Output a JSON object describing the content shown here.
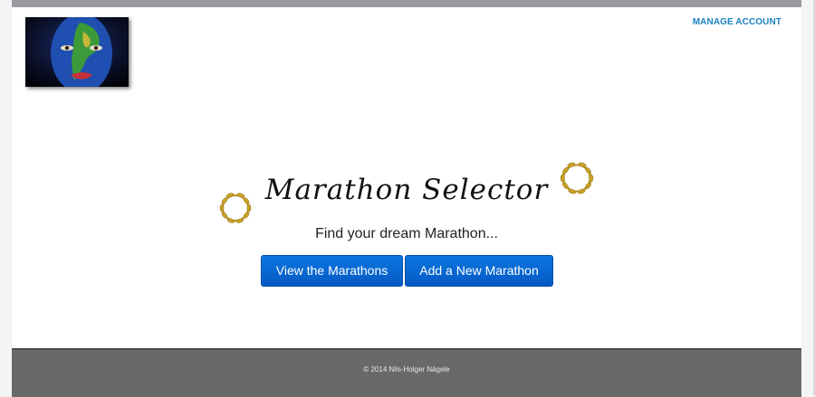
{
  "header": {
    "manage_account": "MANAGE ACCOUNT"
  },
  "logo": {
    "icon": "face-painted-world-map-image"
  },
  "hero": {
    "title": "Marathon Selector",
    "subtitle": "Find your dream Marathon...",
    "buttons": {
      "view": "View the Marathons",
      "add": "Add a New Marathon"
    },
    "decor_icons": [
      "laurel-wreath-icon",
      "laurel-wreath-icon"
    ]
  },
  "footer": {
    "copyright": "© 2014 Nils-Holger Nägele"
  },
  "colors": {
    "link": "#1a82c4",
    "button": "#0559c4",
    "footer": "#696969",
    "topbar": "#9a9aa0",
    "wreath": "#c9a227"
  }
}
